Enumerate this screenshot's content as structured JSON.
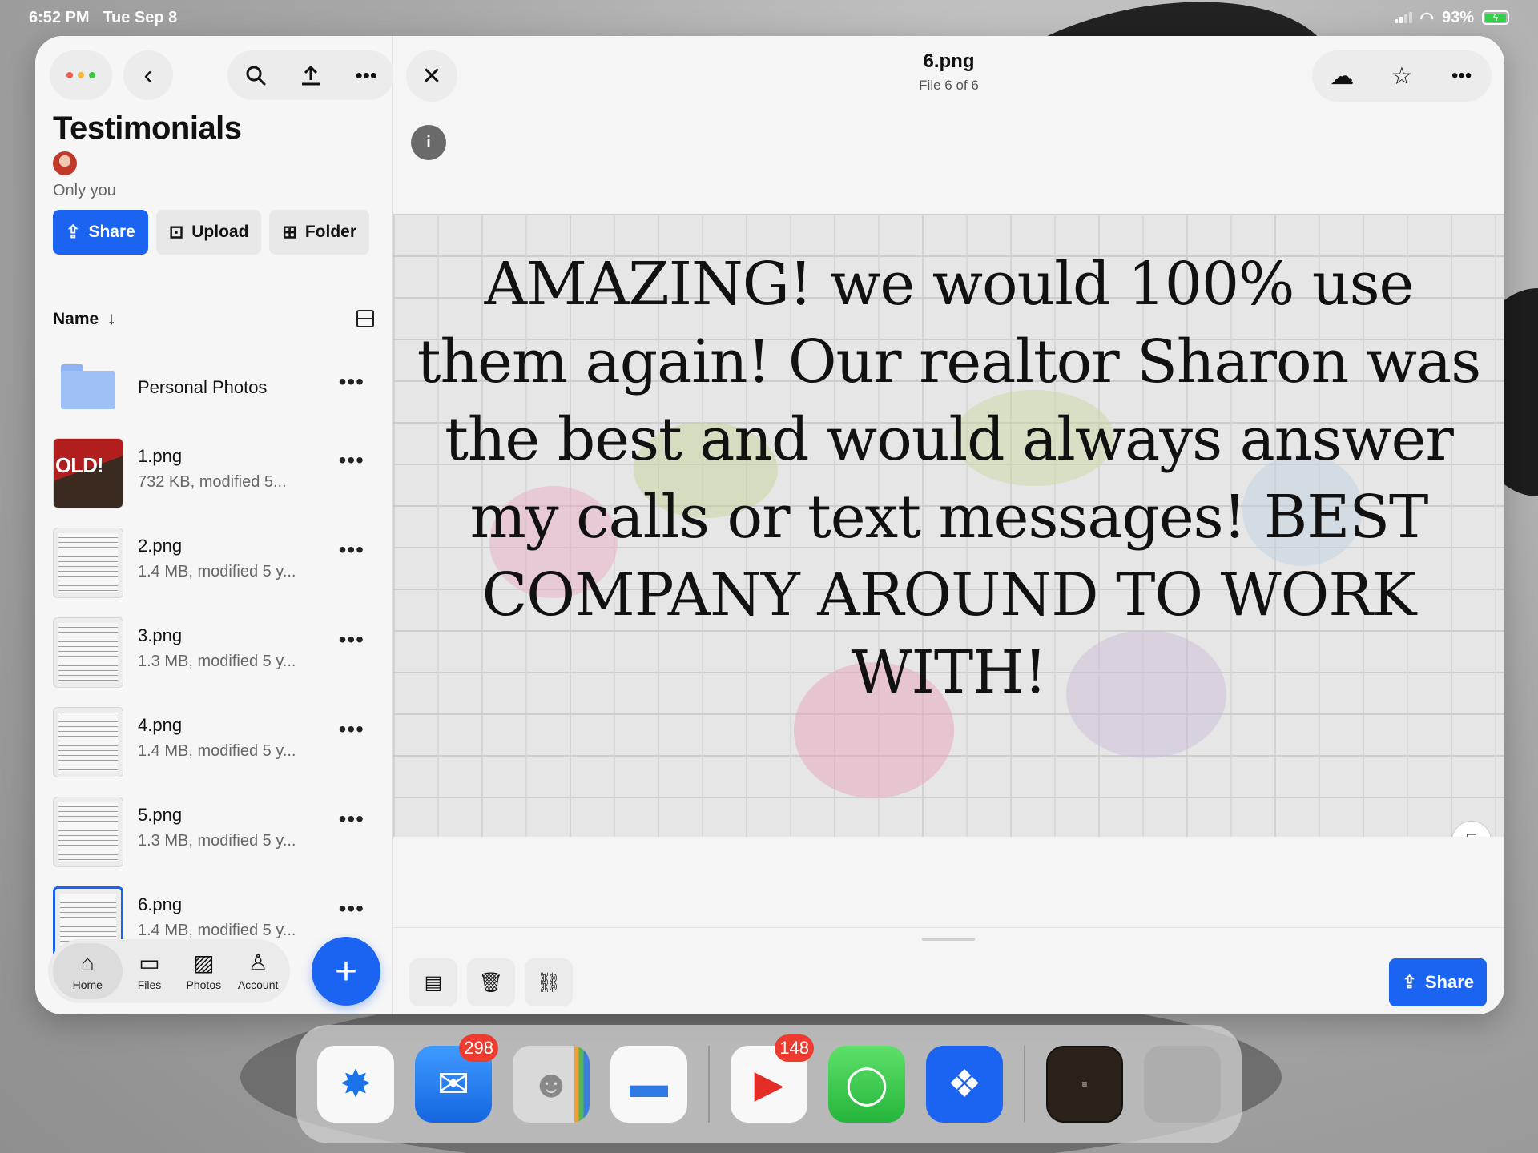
{
  "status_bar": {
    "time": "6:52 PM",
    "date": "Tue Sep 8",
    "battery": "93%"
  },
  "sidebar": {
    "title": "Testimonials",
    "sharing": "Only you",
    "buttons": {
      "share": "Share",
      "upload": "Upload",
      "folder": "Folder"
    },
    "sort_label": "Name",
    "items": [
      {
        "name": "Personal Photos",
        "meta": "",
        "type": "folder"
      },
      {
        "name": "1.png",
        "meta": "732 KB, modified 5...",
        "type": "image"
      },
      {
        "name": "2.png",
        "meta": "1.4 MB, modified 5 y...",
        "type": "image"
      },
      {
        "name": "3.png",
        "meta": "1.3 MB, modified 5 y...",
        "type": "image"
      },
      {
        "name": "4.png",
        "meta": "1.4 MB, modified 5 y...",
        "type": "image"
      },
      {
        "name": "5.png",
        "meta": "1.3 MB, modified 5 y...",
        "type": "image"
      },
      {
        "name": "6.png",
        "meta": "1.4 MB, modified 5 y...",
        "type": "image",
        "selected": true
      }
    ],
    "thumb_text_1": "OLD!"
  },
  "tabbar": {
    "home": "Home",
    "files": "Files",
    "photos": "Photos",
    "account": "Account"
  },
  "viewer": {
    "title": "6.png",
    "subtitle": "File 6 of 6",
    "quote": "AMAZING! we would 100% use them again! Our realtor Sharon was the best and would always answer my calls or text messages! BEST COMPANY AROUND TO WORK WITH!",
    "share_label": "Share"
  },
  "dock": {
    "mail_badge": "298",
    "youtube_badge": "148"
  },
  "colors": {
    "accent": "#1b64f2",
    "badge": "#ee3b30"
  }
}
